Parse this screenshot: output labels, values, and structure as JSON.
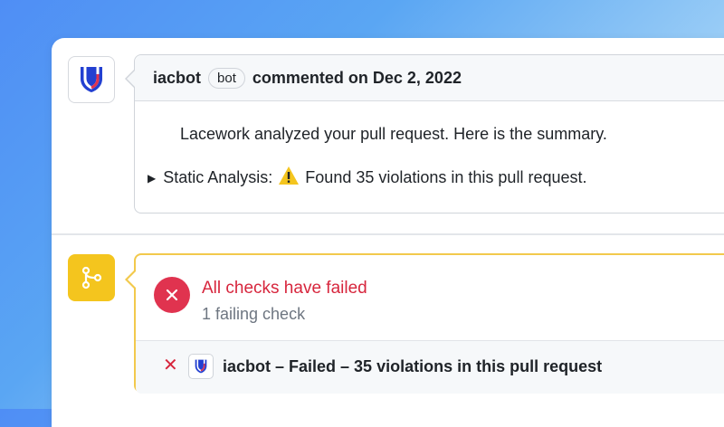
{
  "comment": {
    "author": "iacbot",
    "badge": "bot",
    "date_text": "commented on Dec 2, 2022",
    "summary": "Lacework analyzed your pull request. Here is the summary.",
    "details_label": "Static Analysis:",
    "details_text": "Found 35 violations in this pull request."
  },
  "checks": {
    "title": "All checks have failed",
    "subtitle": "1 failing check",
    "row_text": "iacbot – Failed – 35 violations in this pull request"
  },
  "colors": {
    "fail_red": "#e0334f",
    "warning_yellow": "#f4c51e",
    "brand_blue": "#2340d1"
  },
  "icons": {
    "avatar": "lacework-shield-icon",
    "details": "disclosure-triangle-icon",
    "warning": "warning-icon",
    "git": "git-branch-icon",
    "fail": "close-icon"
  }
}
